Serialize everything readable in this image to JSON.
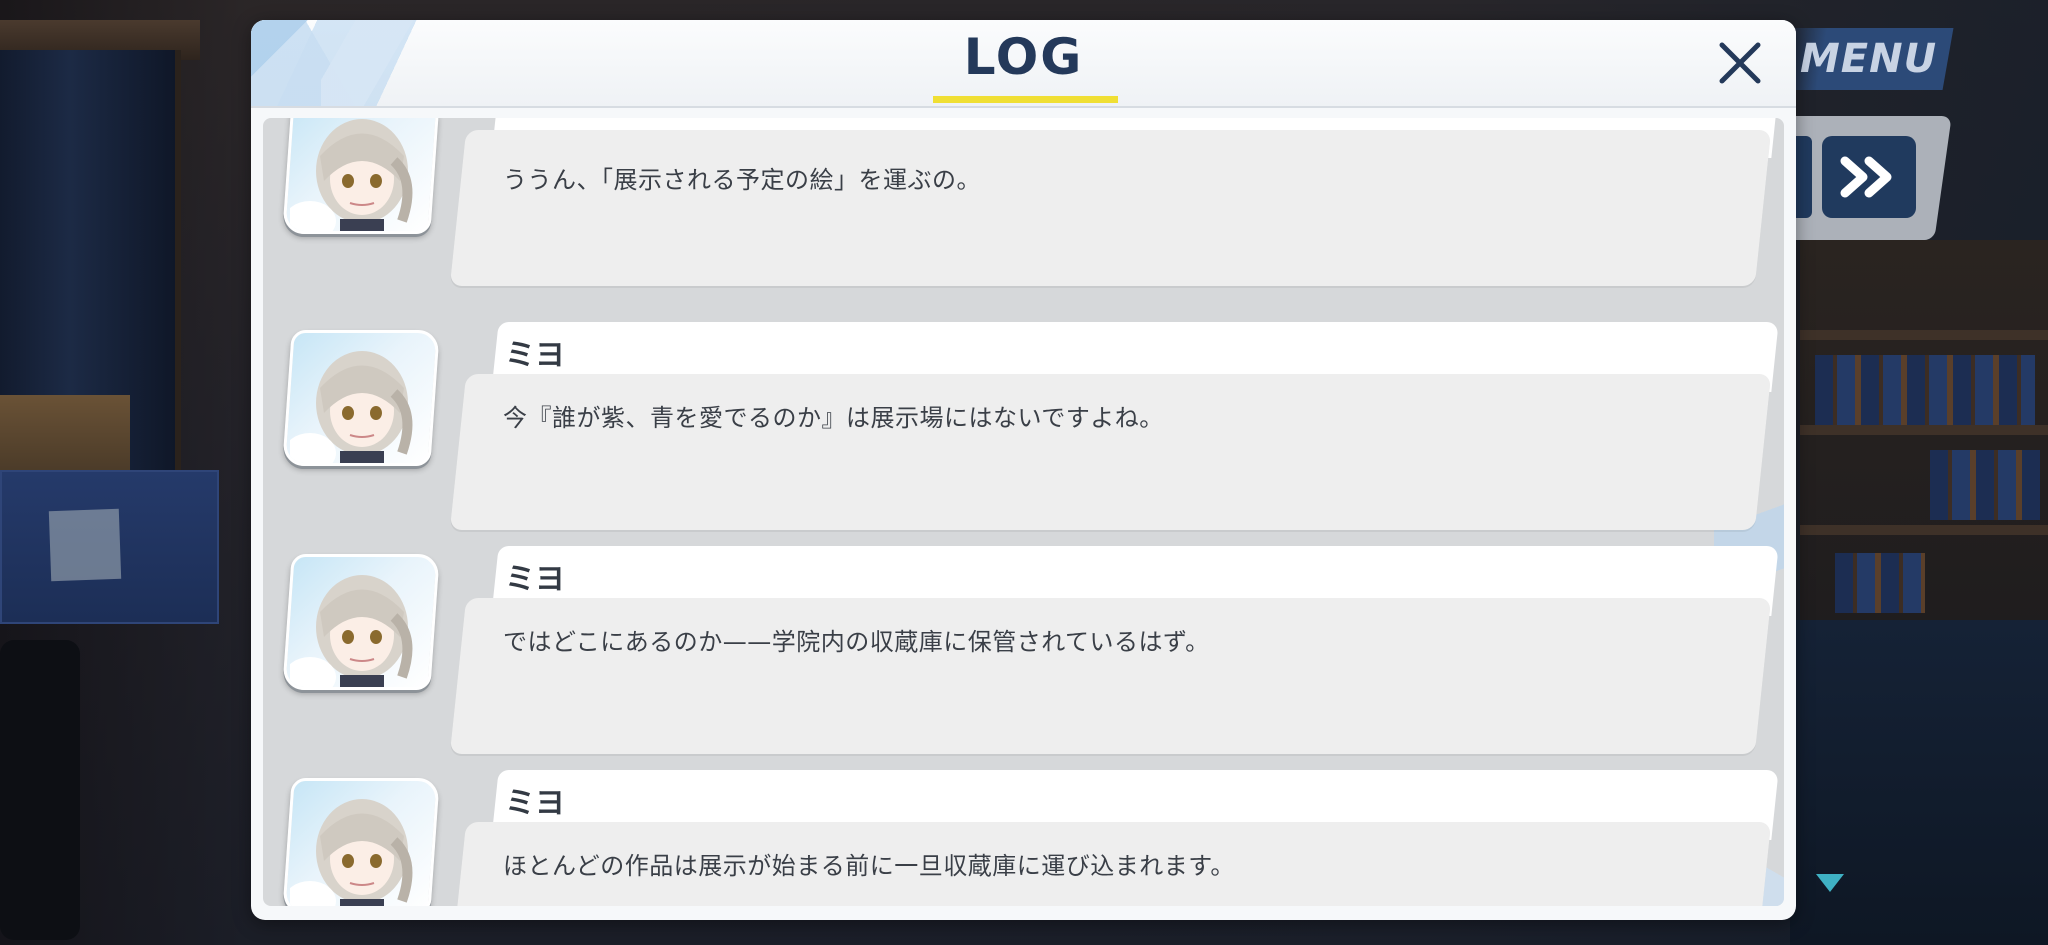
{
  "header": {
    "title": "LOG",
    "accent_color": "#f0df33",
    "close_icon": "close-icon"
  },
  "menu": {
    "label": "MENU",
    "skip_icon": "fast-forward-icon"
  },
  "log": {
    "entries": [
      {
        "speaker": "",
        "text": "ううん、「展示される予定の絵」を運ぶの。"
      },
      {
        "speaker": "ミヨ",
        "text": "今『誰が紫、青を愛でるのか』は展示場にはないですよね。"
      },
      {
        "speaker": "ミヨ",
        "text": "ではどこにあるのか——学院内の収蔵庫に保管されているはず。"
      },
      {
        "speaker": "ミヨ",
        "text": "ほとんどの作品は展示が始まる前に一旦収蔵庫に運び込まれます。"
      }
    ]
  },
  "colors": {
    "title": "#24395a",
    "speaker": "#333a44",
    "text": "#3a3f47",
    "scroll_indicator": "#3fb1c4"
  }
}
